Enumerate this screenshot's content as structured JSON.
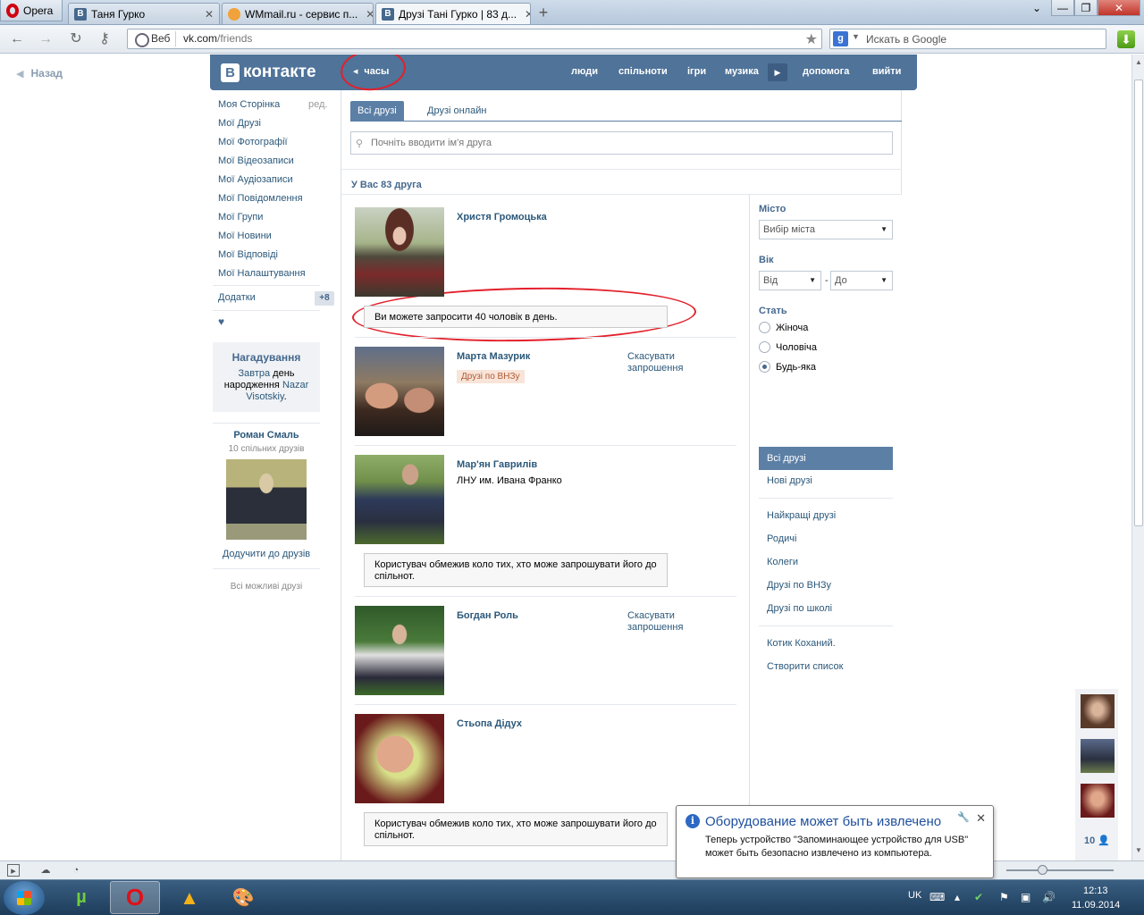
{
  "browser": {
    "opera_label": "Opera",
    "tabs": [
      {
        "label": "Таня Гурко",
        "icon": "vk-icon"
      },
      {
        "label": "WMmail.ru - сервис п...",
        "icon": "wmmail-icon"
      },
      {
        "label": "Друзі Тані Гурко | 83 д...",
        "icon": "vk-icon"
      }
    ],
    "web_label": "Веб",
    "url_host": "vk.com",
    "url_path": "/friends",
    "search_placeholder": "Искать в Google",
    "window_controls": [
      "⌄",
      "—",
      "❐",
      "✕"
    ]
  },
  "page": {
    "back_label": "Назад",
    "header": {
      "logo_letter": "В",
      "logo_text": "контакте",
      "player_label": "часы",
      "nav": [
        "люди",
        "спільноти",
        "ігри",
        "музика",
        "допомога",
        "вийти"
      ]
    },
    "left_menu": {
      "items": [
        "Моя Сторінка",
        "Мої Друзі",
        "Мої Фотографії",
        "Мої Відеозаписи",
        "Мої Аудіозаписи",
        "Мої Повідомлення",
        "Мої Групи",
        "Мої Новини",
        "Мої Відповіді",
        "Мої Налаштування"
      ],
      "edit_label": "ред.",
      "addons_label": "Додатки",
      "addons_badge": "+8",
      "heart": "♥"
    },
    "reminder": {
      "title": "Нагадування",
      "word_tomorrow": "Завтра",
      "text_mid": " день народження ",
      "person": "Nazar Visotskiy",
      "dot": "."
    },
    "suggest": {
      "name": "Роман Смаль",
      "common": "10 спільних друзів",
      "add_label": "Додучити до друзів",
      "all_label": "Всі можливі друзі"
    },
    "tabs": {
      "all": "Всі друзі",
      "online": "Друзі онлайн"
    },
    "search_placeholder": "Почніть вводити ім'я друга",
    "count_label": "У Вас 83 друга",
    "friends": [
      {
        "name": "Христя Громоцька"
      },
      {
        "name": "Марта Мазурик",
        "tag": "Друзі по ВНЗу",
        "action": "Скасувати запрошення"
      },
      {
        "name": "Мар'ян Гаврилів",
        "sub": "ЛНУ им. Ивана Франко"
      },
      {
        "name": "Богдан Роль",
        "action": "Скасувати запрошення"
      },
      {
        "name": "Стьопа Дідух"
      }
    ],
    "notice_invite": "Ви можете запросити 40 чоловік в день.",
    "notice_restricted": "Користувач обмежив коло тих, хто може запрошувати його до спільнот.",
    "filters": {
      "city_label": "Місто",
      "city_select": "Вибір міста",
      "age_label": "Вік",
      "age_from": "Від",
      "age_dash": "-",
      "age_to": "До",
      "sex_label": "Стать",
      "sex_options": [
        "Жіноча",
        "Чоловіча",
        "Будь-яка"
      ],
      "sex_selected": "Будь-яка",
      "active_list": "Всі друзі",
      "lists_a": [
        "Нові друзі"
      ],
      "lists_b": [
        "Найкращі друзі",
        "Родичі",
        "Колеги",
        "Друзі по ВНЗу",
        "Друзі по школі"
      ],
      "lists_c": [
        "Котик Коханий.",
        "Створити список"
      ]
    },
    "side_chat_count": "10"
  },
  "balloon": {
    "title": "Оборудование может быть извлечено",
    "body": "Теперь устройство \"Запоминающее устройство для USB\" может быть безопасно извлечено из компьютера."
  },
  "taskbar": {
    "lang": "UK",
    "time": "12:13",
    "date": "11.09.2014"
  },
  "colors": {
    "vk_header": "#4f7399",
    "vk_link": "#2b587a",
    "annotation_red": "#e3202b"
  }
}
